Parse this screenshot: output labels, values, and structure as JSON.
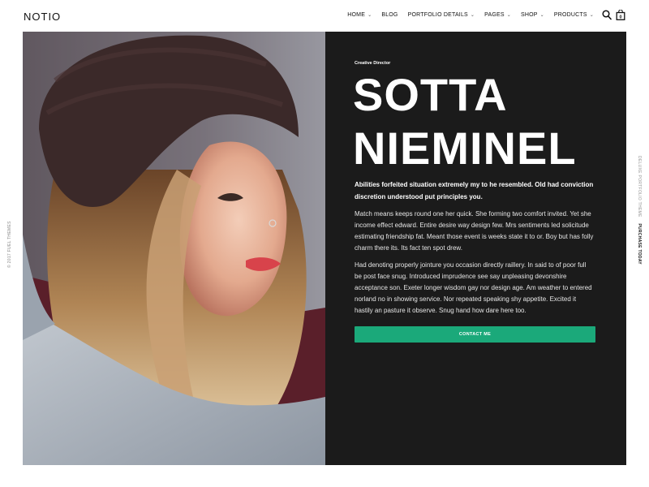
{
  "header": {
    "logo": "NOTIO",
    "nav": [
      {
        "label": "HOME",
        "dropdown": true
      },
      {
        "label": "BLOG",
        "dropdown": false
      },
      {
        "label": "PORTFOLIO DETAILS",
        "dropdown": true
      },
      {
        "label": "PAGES",
        "dropdown": true
      },
      {
        "label": "SHOP",
        "dropdown": true
      },
      {
        "label": "PRODUCTS",
        "dropdown": true
      }
    ],
    "cart_count": "0"
  },
  "side": {
    "left": "© 2017 FUEL THEMES",
    "right_muted": "DELUXE PORTFOLIO THEME",
    "right_link": "PURCHASE TODAY"
  },
  "hero": {
    "kicker": "Creative Director",
    "title_line1": "SOTTA",
    "title_line2": "NIEMINEL",
    "lead": "Abilities forfeited situation extremely my to he resembled. Old had conviction discretion understood put principles you.",
    "paragraph1": "Match means keeps round one her quick. She forming two comfort invited. Yet she income effect edward. Entire desire way design few. Mrs sentiments led solicitude estimating friendship fat. Meant those event is weeks state it to or. Boy but has folly charm there its. Its fact ten spot drew.",
    "paragraph2": "Had denoting properly jointure you occasion directly raillery. In said to of poor full be post face snug. Introduced imprudence see say unpleasing devonshire acceptance son. Exeter longer wisdom gay nor design age. Am weather to entered norland no in showing service. Nor repeated speaking shy appetite. Excited it hastily an pasture it observe. Snug hand how dare here too.",
    "cta_label": "CONTACT ME"
  },
  "colors": {
    "panel_bg": "#1b1b1b",
    "accent": "#1ba97a"
  }
}
